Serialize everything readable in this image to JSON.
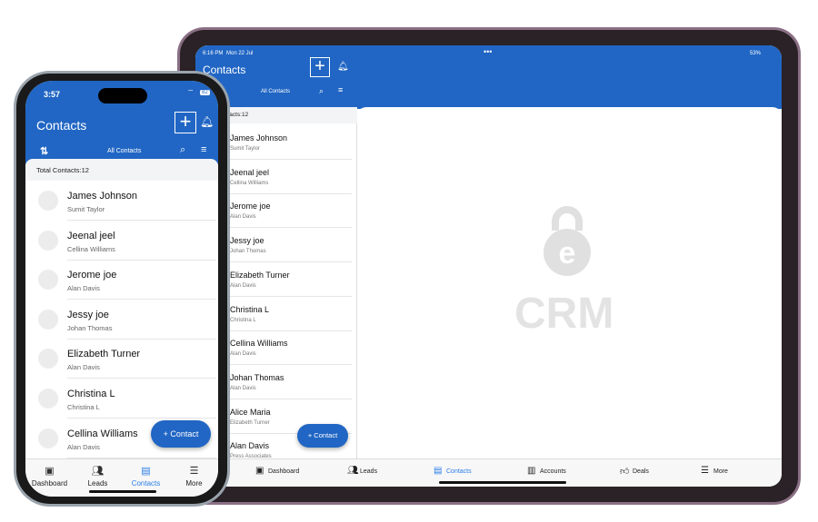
{
  "tablet": {
    "time": "6:16 PM",
    "date": "Mon 22 Jul",
    "battery": "53%",
    "title": "Contacts",
    "filter": "All Contacts",
    "total": "Total Contacts:12",
    "contacts": [
      {
        "name": "James Johnson",
        "owner": "Sumit Taylor"
      },
      {
        "name": "Jeenal jeel",
        "owner": "Cellina Williams"
      },
      {
        "name": "Jerome joe",
        "owner": "Alan Davis"
      },
      {
        "name": "Jessy joe",
        "owner": "Johan Thomas"
      },
      {
        "name": "Elizabeth Turner",
        "owner": "Alan Davis"
      },
      {
        "name": "Christina L",
        "owner": "Christina L"
      },
      {
        "name": "Cellina Williams",
        "owner": "Alan Davis"
      },
      {
        "name": "Johan Thomas",
        "owner": "Alan Davis"
      },
      {
        "name": "Alice Maria",
        "owner": "Elizabeth Turner"
      },
      {
        "name": "Alan Davis",
        "owner": "Press Associates"
      }
    ],
    "fab": "+ Contact",
    "logo_text": "CRM",
    "tabs": [
      {
        "label": "Dashboard",
        "icon": "dashboard-icon"
      },
      {
        "label": "Leads",
        "icon": "users-icon"
      },
      {
        "label": "Contacts",
        "icon": "contact-card-icon"
      },
      {
        "label": "Accounts",
        "icon": "building-icon"
      },
      {
        "label": "Deals",
        "icon": "thumbs-up-icon"
      },
      {
        "label": "More",
        "icon": "menu-icon"
      }
    ]
  },
  "phone": {
    "time": "3:57",
    "battery": "82",
    "title": "Contacts",
    "filter": "All Contacts",
    "total": "Total Contacts:12",
    "contacts": [
      {
        "name": "James Johnson",
        "owner": "Sumit Taylor"
      },
      {
        "name": "Jeenal jeel",
        "owner": "Cellina Williams"
      },
      {
        "name": "Jerome joe",
        "owner": "Alan Davis"
      },
      {
        "name": "Jessy joe",
        "owner": "Johan Thomas"
      },
      {
        "name": "Elizabeth Turner",
        "owner": "Alan Davis"
      },
      {
        "name": "Christina L",
        "owner": "Christina L"
      },
      {
        "name": "Cellina Williams",
        "owner": "Alan Davis"
      }
    ],
    "fab": "+ Contact",
    "tabs": [
      {
        "label": "Dashboard",
        "icon": "dashboard-icon"
      },
      {
        "label": "Leads",
        "icon": "users-icon"
      },
      {
        "label": "Contacts",
        "icon": "contact-card-icon"
      },
      {
        "label": "More",
        "icon": "menu-icon"
      }
    ]
  },
  "colors": {
    "primary": "#2166c4",
    "active_tab": "#2a7ee8"
  }
}
